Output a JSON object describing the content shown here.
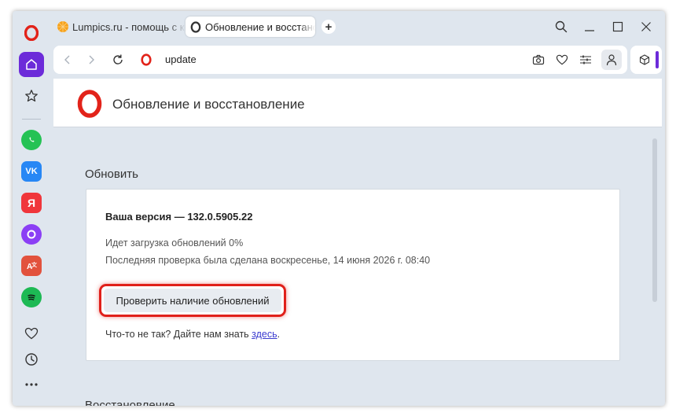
{
  "tabs": [
    {
      "label": "Lumpics.ru - помощь с ко",
      "active": false,
      "icon": "orange-icon"
    },
    {
      "label": "Обновление и восстанов",
      "active": true,
      "icon": "opera-icon"
    }
  ],
  "address_bar": {
    "url": "update"
  },
  "page": {
    "header_title": "Обновление и восстановление",
    "update_section_title": "Обновить",
    "version_label": "Ваша версия — 132.0.5905.22",
    "download_status": "Идет загрузка обновлений 0%",
    "last_check": "Последняя проверка была сделана воскресенье, 14 июня 2026 г. 08:40",
    "check_button_label": "Проверить наличие обновлений",
    "feedback_prefix": "Что-то не так? Дайте нам знать ",
    "feedback_link": "здесь",
    "feedback_suffix": ".",
    "recovery_section_title": "Восстановление"
  },
  "sidebar": {
    "apps": [
      "whatsapp-icon",
      "vk-icon",
      "yandex-icon",
      "alice-icon",
      "translate-icon",
      "spotify-icon"
    ],
    "vk_letter": "VK",
    "yandex_letter": "Я"
  },
  "colors": {
    "accent": "#6c2bd9",
    "highlight_border": "#e0201a",
    "opera_red": "#e2231a",
    "link": "#3a3acf"
  }
}
